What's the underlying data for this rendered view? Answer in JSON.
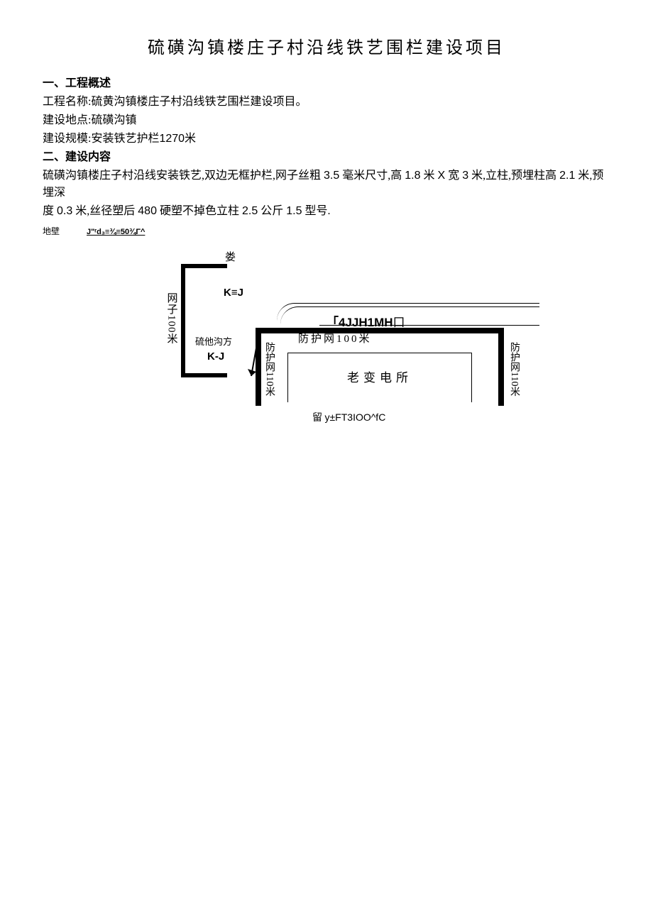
{
  "title": "硫磺沟镇楼庄子村沿线铁艺围栏建设项目",
  "s1": {
    "h": "一、工程概述",
    "p1": "工程名称:硫黄沟镇楼庄子村沿线铁艺围栏建设项目。",
    "p2": "建设地点:硫磺沟镇",
    "p3_a": "建设规模:安装铁艺护栏",
    "p3_b": "1270",
    "p3_c": "米"
  },
  "s2": {
    "h": "二、建设内容",
    "l1a": "硫磺沟镇楼庄子村沿线安装铁艺,双边无框护栏,网子丝粗",
    "l1b": "3.5",
    "l1c": "毫米尺寸,高",
    "l1d": "1.8",
    "l1e": "米",
    "l1f": "X",
    "l1g": "宽",
    "l1h": "3",
    "l1i": "米,立柱,预埋柱高",
    "l1j": "2.1",
    "l1k": "米,预埋深",
    "l2a": "度",
    "l2b": "0.3",
    "l2c": "米,丝径塑后",
    "l2d": "480",
    "l2e": "硬塑不掉色立柱",
    "l2f": "2.5",
    "l2g": "公斤",
    "l2h": "1.5",
    "l2i": "型号."
  },
  "sm": {
    "a": "地壁",
    "b": "J\"ʳd₃≡¾≡50¾Γ^"
  },
  "dg": {
    "lou": "娄",
    "kj": "K≡J",
    "v1": "网子100米",
    "sf": "硫他沟方",
    "kj2": "K-J",
    "code": "「4JJH1MH",
    "code_cn": "口",
    "topnet": "防护网100米",
    "lnet": "防护网110米",
    "rnet": "防护网110米",
    "center": "老变电所",
    "bot_a": "留",
    "bot_b": "y±FT3IOO^fC"
  }
}
